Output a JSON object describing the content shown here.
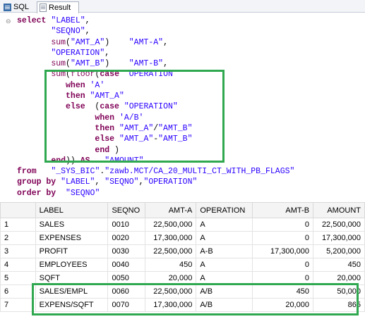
{
  "tabs": [
    {
      "label": "SQL",
      "icon": "sql-icon"
    },
    {
      "label": "Result",
      "icon": "result-icon"
    }
  ],
  "editor": {
    "fold_marker": "⊖",
    "lines": [
      [
        [
          "kw",
          "select "
        ],
        [
          "str",
          "\"LABEL\""
        ],
        [
          "pl",
          ","
        ]
      ],
      [
        [
          "pl",
          "       "
        ],
        [
          "str",
          "\"SEQNO\""
        ],
        [
          "pl",
          ","
        ]
      ],
      [
        [
          "pl",
          "       "
        ],
        [
          "fn",
          "sum"
        ],
        [
          "pl",
          "("
        ],
        [
          "str",
          "\"AMT_A\""
        ],
        [
          "pl",
          ")    "
        ],
        [
          "str",
          "\"AMT-A\""
        ],
        [
          "pl",
          ","
        ]
      ],
      [
        [
          "pl",
          "       "
        ],
        [
          "str",
          "\"OPERATION\""
        ],
        [
          "pl",
          ","
        ]
      ],
      [
        [
          "pl",
          "       "
        ],
        [
          "fn",
          "sum"
        ],
        [
          "pl",
          "("
        ],
        [
          "str",
          "\"AMT_B\""
        ],
        [
          "pl",
          ")    "
        ],
        [
          "str",
          "\"AMT-B\""
        ],
        [
          "pl",
          ","
        ]
      ],
      [
        [
          "pl",
          "       "
        ],
        [
          "fn",
          "sum"
        ],
        [
          "pl",
          "("
        ],
        [
          "fn",
          "floor"
        ],
        [
          "pl",
          "("
        ],
        [
          "kw",
          "case"
        ],
        [
          "pl",
          "  "
        ],
        [
          "str",
          "OPERATION"
        ]
      ],
      [
        [
          "pl",
          "          "
        ],
        [
          "kw",
          "when"
        ],
        [
          "pl",
          " "
        ],
        [
          "str",
          "'A'"
        ]
      ],
      [
        [
          "pl",
          "          "
        ],
        [
          "kw",
          "then"
        ],
        [
          "pl",
          " "
        ],
        [
          "str",
          "\"AMT_A\""
        ]
      ],
      [
        [
          "pl",
          "          "
        ],
        [
          "kw",
          "else"
        ],
        [
          "pl",
          "  ("
        ],
        [
          "kw",
          "case"
        ],
        [
          "pl",
          " "
        ],
        [
          "str",
          "\"OPERATION\""
        ]
      ],
      [
        [
          "pl",
          "                "
        ],
        [
          "kw",
          "when"
        ],
        [
          "pl",
          " "
        ],
        [
          "str",
          "'A/B'"
        ]
      ],
      [
        [
          "pl",
          "                "
        ],
        [
          "kw",
          "then"
        ],
        [
          "pl",
          " "
        ],
        [
          "str",
          "\"AMT_A\""
        ],
        [
          "pl",
          "/"
        ],
        [
          "str",
          "\"AMT_B\""
        ]
      ],
      [
        [
          "pl",
          "                "
        ],
        [
          "kw",
          "else"
        ],
        [
          "pl",
          " "
        ],
        [
          "str",
          "\"AMT_A\""
        ],
        [
          "pl",
          "-"
        ],
        [
          "str",
          "\"AMT_B\""
        ]
      ],
      [
        [
          "pl",
          "                "
        ],
        [
          "kw",
          "end"
        ],
        [
          "pl",
          " )"
        ]
      ],
      [
        [
          "pl",
          "       "
        ],
        [
          "kw",
          "end"
        ],
        [
          "pl",
          ")) "
        ],
        [
          "kw",
          "AS"
        ],
        [
          "pl",
          "   "
        ],
        [
          "str",
          "\"AMOUNT\""
        ]
      ],
      [
        [
          "kw",
          "from"
        ],
        [
          "pl",
          "   "
        ],
        [
          "str",
          "\"_SYS_BIC\""
        ],
        [
          "pl",
          "."
        ],
        [
          "str",
          "\"zawb.MCT/CA_20_MULTI_CT_WITH_PB_FLAGS\""
        ]
      ],
      [
        [
          "kw",
          "group by"
        ],
        [
          "pl",
          " "
        ],
        [
          "str",
          "\"LABEL\""
        ],
        [
          "pl",
          ", "
        ],
        [
          "str",
          "\"SEQNO\""
        ],
        [
          "pl",
          ","
        ],
        [
          "str",
          "\"OPERATION\""
        ]
      ],
      [
        [
          "kw",
          "order by"
        ],
        [
          "pl",
          "  "
        ],
        [
          "str",
          "\"SEQNO\""
        ]
      ]
    ]
  },
  "result": {
    "columns": [
      {
        "label": "",
        "align": "idx"
      },
      {
        "label": "LABEL",
        "align": "txt"
      },
      {
        "label": "SEQNO",
        "align": "txt"
      },
      {
        "label": "AMT-A",
        "align": "num"
      },
      {
        "label": "OPERATION",
        "align": "txt"
      },
      {
        "label": "AMT-B",
        "align": "num"
      },
      {
        "label": "AMOUNT",
        "align": "num"
      }
    ],
    "rows": [
      [
        "1",
        "SALES",
        "0010",
        "22,500,000",
        "A",
        "0",
        "22,500,000"
      ],
      [
        "2",
        "EXPENSES",
        "0020",
        "17,300,000",
        "A",
        "0",
        "17,300,000"
      ],
      [
        "3",
        "PROFIT",
        "0030",
        "22,500,000",
        "A-B",
        "17,300,000",
        "5,200,000"
      ],
      [
        "4",
        "EMPLOYEES",
        "0040",
        "450",
        "A",
        "0",
        "450"
      ],
      [
        "5",
        "SQFT",
        "0050",
        "20,000",
        "A",
        "0",
        "20,000"
      ],
      [
        "6",
        "SALES/EMPL",
        "0060",
        "22,500,000",
        "A/B",
        "450",
        "50,000"
      ],
      [
        "7",
        "EXPENS/SQFT",
        "0070",
        "17,300,000",
        "A/B",
        "20,000",
        "865"
      ]
    ]
  },
  "highlight_color": "#2fa84f"
}
